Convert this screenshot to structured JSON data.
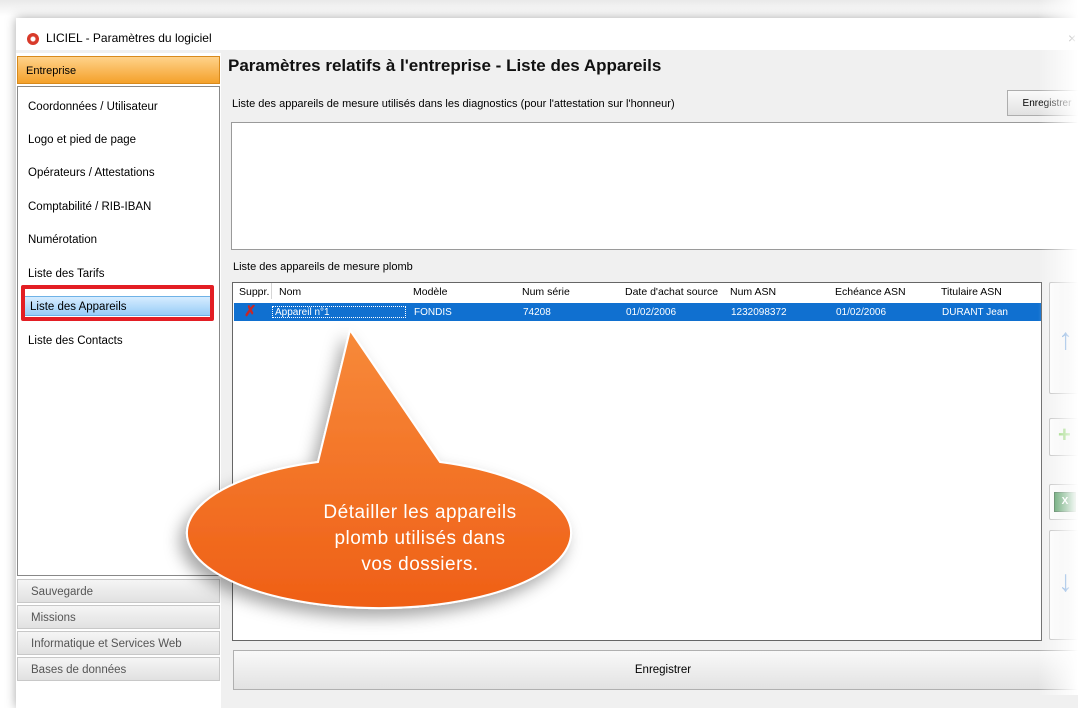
{
  "window": {
    "title": "LICIEL - Paramètres du logiciel",
    "close_glyph": "×"
  },
  "sidebar": {
    "header": "Entreprise",
    "items": [
      {
        "label": "Coordonnées / Utilisateur"
      },
      {
        "label": "Logo et pied de page"
      },
      {
        "label": "Opérateurs / Attestations"
      },
      {
        "label": "Comptabilité / RIB-IBAN"
      },
      {
        "label": "Numérotation"
      },
      {
        "label": "Liste des Tarifs"
      },
      {
        "label": "Liste des Appareils"
      },
      {
        "label": "Liste des Contacts"
      }
    ],
    "selected": "Liste des Appareils",
    "sections": [
      "Sauvegarde",
      "Missions",
      "Informatique et Services Web",
      "Bases de données"
    ]
  },
  "main": {
    "title": "Paramètres relatifs à l'entreprise - Liste des Appareils",
    "description": "Liste des appareils de mesure utilisés dans les diagnostics (pour l'attestation sur l'honneur)",
    "save_top": "Enregistrer",
    "plomb_label": "Liste des appareils de mesure plomb",
    "table": {
      "headers": [
        "Suppr.",
        "Nom",
        "Modèle",
        "Num série",
        "Date d'achat source",
        "Num ASN",
        "Echéance ASN",
        "Titulaire ASN"
      ],
      "rows": [
        {
          "nom": "Appareil n°1",
          "modele": "FONDIS",
          "num_serie": "74208",
          "date_achat": "01/02/2006",
          "num_asn": "1232098372",
          "echeance": "01/02/2006",
          "titulaire": "DURANT Jean"
        }
      ]
    },
    "icons": {
      "delete": "delete-x-icon",
      "up": "arrow-up-icon",
      "down": "arrow-down-icon",
      "add": "plus-icon",
      "excel": "excel-icon"
    },
    "excel_glyph": "X",
    "save_bottom": "Enregistrer"
  },
  "callout": {
    "line1": "Détailler les appareils",
    "line2": "plomb utilisés dans",
    "line3": "vos dossiers."
  },
  "colors": {
    "accent_orange": "#f4a12b",
    "selection_blue": "#1070d0",
    "callout": "#f26722",
    "highlight_red": "#e31e24"
  }
}
